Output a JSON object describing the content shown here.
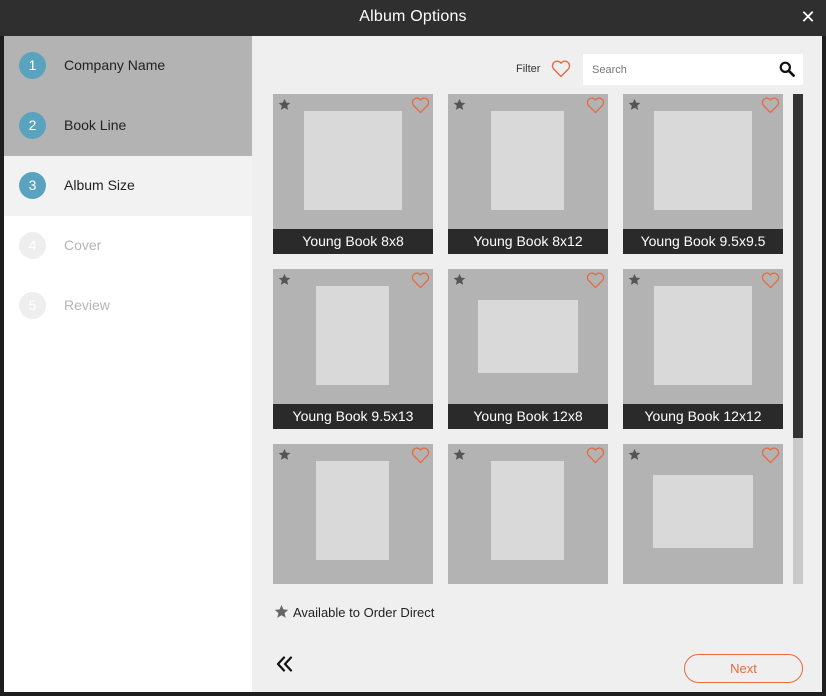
{
  "window": {
    "title": "Album Options",
    "close_glyph": "✕"
  },
  "steps": [
    {
      "number": "1",
      "label": "Company Name",
      "state": "done"
    },
    {
      "number": "2",
      "label": "Book Line",
      "state": "done"
    },
    {
      "number": "3",
      "label": "Album Size",
      "state": "active"
    },
    {
      "number": "4",
      "label": "Cover",
      "state": "todo"
    },
    {
      "number": "5",
      "label": "Review",
      "state": "todo"
    }
  ],
  "toolbar": {
    "filter_label": "Filter",
    "search_placeholder": "Search"
  },
  "albums": [
    {
      "name": "Young Book 8x8"
    },
    {
      "name": "Young Book 8x12"
    },
    {
      "name": "Young Book 9.5x9.5"
    },
    {
      "name": "Young Book 9.5x13"
    },
    {
      "name": "Young Book 12x8"
    },
    {
      "name": "Young Book 12x12"
    },
    {
      "name": ""
    },
    {
      "name": ""
    },
    {
      "name": ""
    }
  ],
  "legend": {
    "text": "Available to Order Direct"
  },
  "footer": {
    "back_icon": "double-chevron-left-icon",
    "next_label": "Next"
  },
  "colors": {
    "accent": "#e86a42",
    "step_badge": "#5aa3bf",
    "card_bg": "#b3b3b3",
    "caption_bg": "#2a2a2a"
  }
}
